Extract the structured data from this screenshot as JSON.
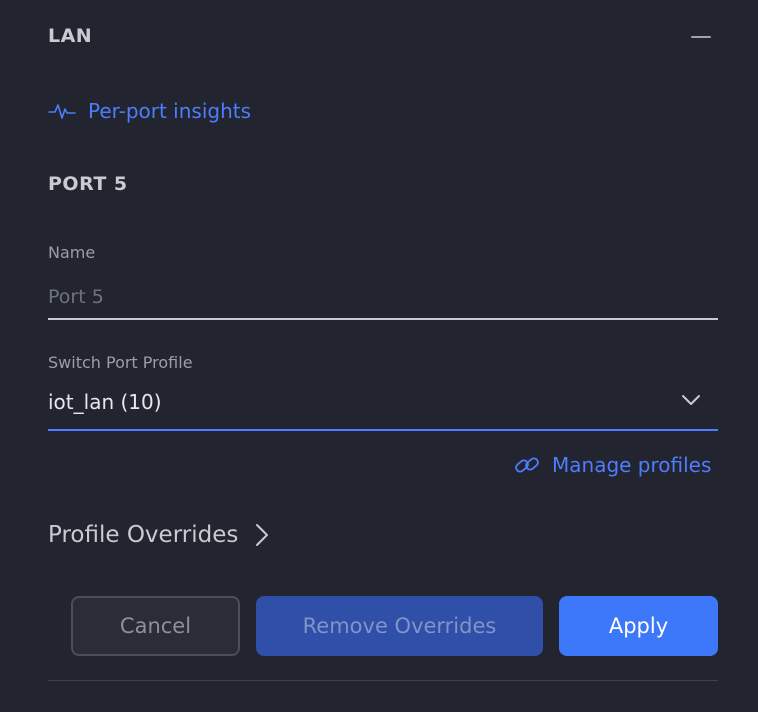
{
  "section": {
    "title": "LAN"
  },
  "insights": {
    "label": "Per-port insights",
    "icon": "pulse-icon"
  },
  "port": {
    "title": "PORT 5"
  },
  "name_field": {
    "label": "Name",
    "placeholder": "Port 5",
    "value": ""
  },
  "profile_field": {
    "label": "Switch Port Profile",
    "value": "iot_lan (10)"
  },
  "manage_profiles": {
    "label": "Manage profiles",
    "icon": "link-icon"
  },
  "overrides": {
    "label": "Profile Overrides"
  },
  "actions": {
    "cancel": "Cancel",
    "remove_overrides": "Remove Overrides",
    "apply": "Apply"
  },
  "colors": {
    "background": "#22242f",
    "accent": "#4d7dfc",
    "apply": "#3d78fb",
    "remove_disabled": "#2f4fa8"
  }
}
